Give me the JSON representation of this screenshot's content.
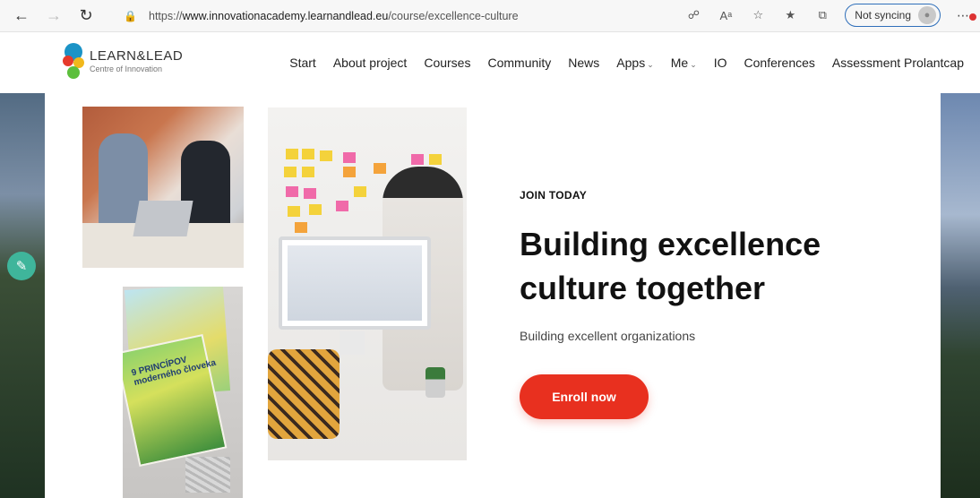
{
  "browser": {
    "url_prefix": "https://",
    "url_domain": "www.innovationacademy.learnandlead.eu",
    "url_path": "/course/excellence-culture",
    "sync_label": "Not syncing",
    "icons": [
      "back-icon",
      "forward-icon",
      "refresh-icon",
      "lock-icon",
      "read-aloud-icon",
      "text-size-icon",
      "add-favorite-icon",
      "favorites-icon",
      "collections-icon",
      "profile-icon",
      "more-icon"
    ]
  },
  "site": {
    "logo_name": "LEARN&LEAD",
    "logo_tagline": "Centre of Innovation",
    "brand_colors": [
      "#1b93c6",
      "#e63a2b",
      "#f1b81b",
      "#5cbf3c"
    ],
    "nav": [
      {
        "label": "Start"
      },
      {
        "label": "About project"
      },
      {
        "label": "Courses"
      },
      {
        "label": "Community"
      },
      {
        "label": "News"
      },
      {
        "label": "Apps",
        "dropdown": true
      },
      {
        "label": "Me",
        "dropdown": true
      },
      {
        "label": "IO"
      },
      {
        "label": "Conferences"
      },
      {
        "label": "Assessment Prolantcap"
      }
    ]
  },
  "photos": {
    "book_title_line1": "9 PRINCÍPOV",
    "book_title_line2": "moderného človeka",
    "book_cover_script": "Princíp"
  },
  "hero": {
    "eyebrow": "JOIN TODAY",
    "title_line1": "Building excellence",
    "title_line2": "culture together",
    "subtitle": "Building excellent organizations",
    "cta_label": "Enroll now",
    "cta_color": "#e8301f"
  }
}
